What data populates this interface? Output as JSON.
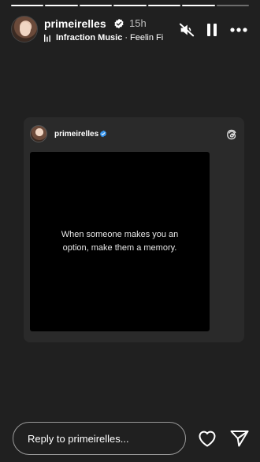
{
  "story": {
    "progress": {
      "total_segments": 7,
      "completed_segments": 6
    },
    "header": {
      "username": "primeirelles",
      "time_ago": "15h",
      "music": {
        "artist": "Infraction Music",
        "separator": "·",
        "track": "Feelin Fi"
      }
    },
    "card": {
      "username": "primeirelles",
      "quote": "When someone makes you an option, make them a memory."
    },
    "reply": {
      "placeholder": "Reply to primeirelles..."
    }
  },
  "colors": {
    "background": "#202020",
    "card": "#2a2a2a",
    "verified": "#3897f0"
  }
}
